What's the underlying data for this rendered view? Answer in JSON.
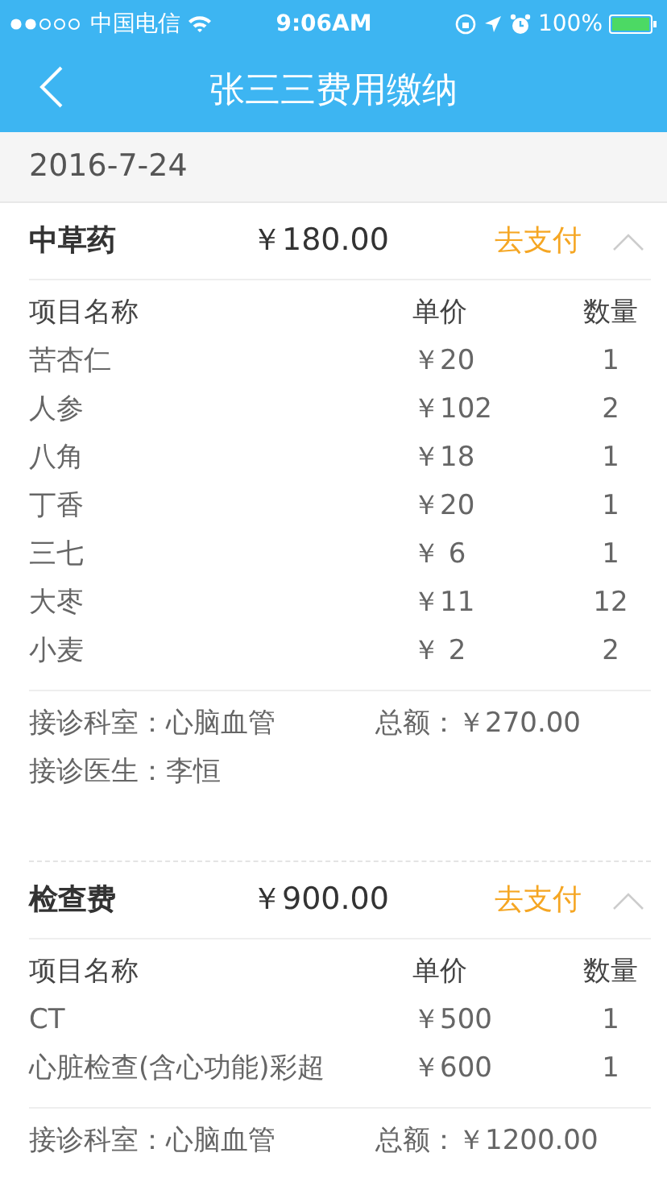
{
  "status_bar": {
    "carrier": "中国电信",
    "time": "9:06AM",
    "battery": "100%"
  },
  "nav": {
    "title": "张三三费用缴纳"
  },
  "date": "2016-7-24",
  "groups": [
    {
      "category": "中草药",
      "amount": "￥180.00",
      "pay": "去支付",
      "expanded": true,
      "columns": [
        "项目名称",
        "单价",
        "数量"
      ],
      "items": [
        {
          "name": "苦杏仁",
          "price": "￥20",
          "qty": "1"
        },
        {
          "name": "人参",
          "price": "￥102",
          "qty": "2"
        },
        {
          "name": "八角",
          "price": "￥18",
          "qty": "1"
        },
        {
          "name": "丁香",
          "price": "￥20",
          "qty": "1"
        },
        {
          "name": "三七",
          "price": "￥ 6",
          "qty": "1"
        },
        {
          "name": "大枣",
          "price": "￥11",
          "qty": "12"
        },
        {
          "name": "小麦",
          "price": "￥ 2",
          "qty": "2"
        }
      ],
      "department": "接诊科室：心脑血管",
      "total": "总额：￥270.00",
      "doctor": "接诊医生：李恒"
    },
    {
      "category": "检查费",
      "amount": "￥900.00",
      "pay": "去支付",
      "expanded": true,
      "columns": [
        "项目名称",
        "单价",
        "数量"
      ],
      "items": [
        {
          "name": "CT",
          "price": "￥500",
          "qty": "1"
        },
        {
          "name": "心脏检查(含心功能)彩超",
          "price": "￥600",
          "qty": "1"
        }
      ],
      "department": "接诊科室：心脑血管",
      "total": "总额：￥1200.00"
    }
  ]
}
